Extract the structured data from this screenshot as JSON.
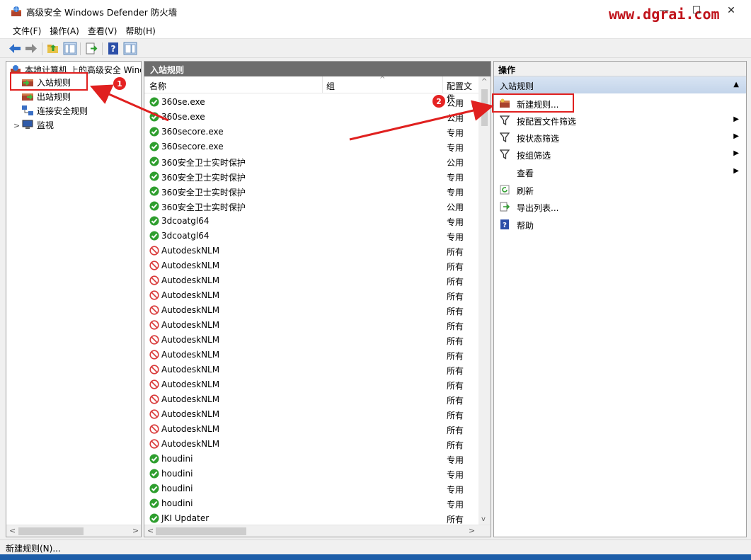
{
  "window": {
    "title": "高级安全 Windows Defender 防火墙",
    "watermark": "www.dgrai.com",
    "minimize": "—",
    "maximize": "☐",
    "close": "✕"
  },
  "menu": [
    {
      "label": "文件(F)"
    },
    {
      "label": "操作(A)"
    },
    {
      "label": "查看(V)"
    },
    {
      "label": "帮助(H)"
    }
  ],
  "tree": {
    "root": "本地计算机 上的高级安全 Windows Defender 防火墙",
    "items": [
      {
        "label": "入站规则",
        "icon": "inbound-rules-icon"
      },
      {
        "label": "出站规则",
        "icon": "outbound-rules-icon"
      },
      {
        "label": "连接安全规则",
        "icon": "connection-security-icon"
      },
      {
        "label": "监视",
        "icon": "monitor-icon"
      }
    ],
    "expander": ">"
  },
  "middle": {
    "header": "入站规则",
    "columns": {
      "name": "名称",
      "group": "组",
      "profile": "配置文件"
    },
    "rows": [
      {
        "name": "360se.exe",
        "profile": "公用",
        "enabled": true
      },
      {
        "name": "360se.exe",
        "profile": "公用",
        "enabled": true
      },
      {
        "name": "360secore.exe",
        "profile": "专用",
        "enabled": true
      },
      {
        "name": "360secore.exe",
        "profile": "专用",
        "enabled": true
      },
      {
        "name": "360安全卫士实时保护",
        "profile": "公用",
        "enabled": true
      },
      {
        "name": "360安全卫士实时保护",
        "profile": "专用",
        "enabled": true
      },
      {
        "name": "360安全卫士实时保护",
        "profile": "专用",
        "enabled": true
      },
      {
        "name": "360安全卫士实时保护",
        "profile": "公用",
        "enabled": true
      },
      {
        "name": "3dcoatgl64",
        "profile": "专用",
        "enabled": true
      },
      {
        "name": "3dcoatgl64",
        "profile": "专用",
        "enabled": true
      },
      {
        "name": "AutodeskNLM",
        "profile": "所有",
        "enabled": false
      },
      {
        "name": "AutodeskNLM",
        "profile": "所有",
        "enabled": false
      },
      {
        "name": "AutodeskNLM",
        "profile": "所有",
        "enabled": false
      },
      {
        "name": "AutodeskNLM",
        "profile": "所有",
        "enabled": false
      },
      {
        "name": "AutodeskNLM",
        "profile": "所有",
        "enabled": false
      },
      {
        "name": "AutodeskNLM",
        "profile": "所有",
        "enabled": false
      },
      {
        "name": "AutodeskNLM",
        "profile": "所有",
        "enabled": false
      },
      {
        "name": "AutodeskNLM",
        "profile": "所有",
        "enabled": false
      },
      {
        "name": "AutodeskNLM",
        "profile": "所有",
        "enabled": false
      },
      {
        "name": "AutodeskNLM",
        "profile": "所有",
        "enabled": false
      },
      {
        "name": "AutodeskNLM",
        "profile": "所有",
        "enabled": false
      },
      {
        "name": "AutodeskNLM",
        "profile": "所有",
        "enabled": false
      },
      {
        "name": "AutodeskNLM",
        "profile": "所有",
        "enabled": false
      },
      {
        "name": "AutodeskNLM",
        "profile": "所有",
        "enabled": false
      },
      {
        "name": "houdini",
        "profile": "专用",
        "enabled": true
      },
      {
        "name": "houdini",
        "profile": "专用",
        "enabled": true
      },
      {
        "name": "houdini",
        "profile": "专用",
        "enabled": true
      },
      {
        "name": "houdini",
        "profile": "专用",
        "enabled": true
      },
      {
        "name": "JKI Updater",
        "profile": "所有",
        "enabled": true
      }
    ]
  },
  "actions": {
    "header": "操作",
    "section": "入站规则",
    "items": [
      {
        "label": "新建规则...",
        "icon": "new-rule-icon",
        "submenu": false
      },
      {
        "label": "按配置文件筛选",
        "icon": "filter-icon",
        "submenu": true
      },
      {
        "label": "按状态筛选",
        "icon": "filter-icon",
        "submenu": true
      },
      {
        "label": "按组筛选",
        "icon": "filter-icon",
        "submenu": true
      },
      {
        "label": "查看",
        "icon": "",
        "submenu": true
      },
      {
        "label": "刷新",
        "icon": "refresh-icon",
        "submenu": false
      },
      {
        "label": "导出列表...",
        "icon": "export-icon",
        "submenu": false
      },
      {
        "label": "帮助",
        "icon": "help-icon",
        "submenu": false
      }
    ]
  },
  "status": "新建规则(N)...",
  "annotations": {
    "badge1": "1",
    "badge2": "2"
  },
  "colors": {
    "accent_red": "#e0201f",
    "enabled_green": "#2e9e2e",
    "disabled_red": "#d93a3a"
  }
}
